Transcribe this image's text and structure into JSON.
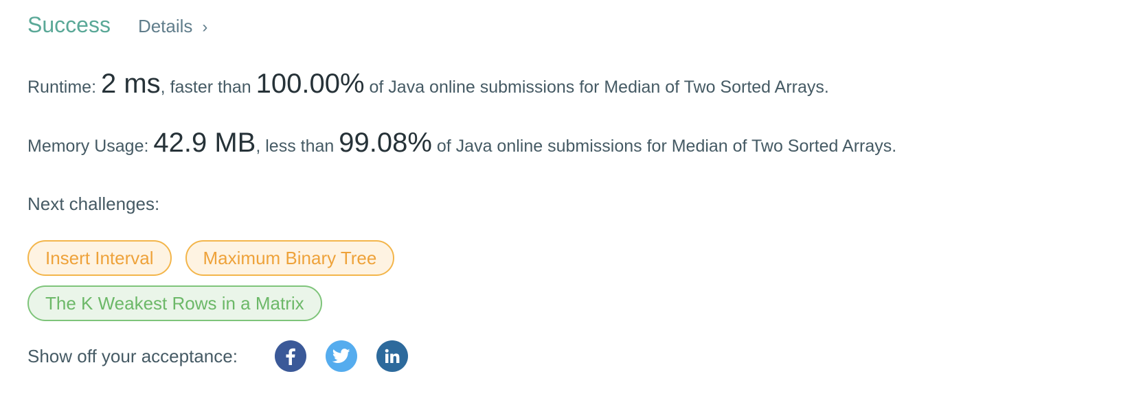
{
  "header": {
    "status": "Success",
    "details_label": "Details",
    "chevron": "›"
  },
  "runtime": {
    "label": "Runtime: ",
    "value": "2 ms",
    "comparison": ", faster than ",
    "percent": "100.00%",
    "suffix": " of Java online submissions for Median of Two Sorted Arrays."
  },
  "memory": {
    "label": "Memory Usage: ",
    "value": "42.9 MB",
    "comparison": ", less than ",
    "percent": "99.08%",
    "suffix": " of Java online submissions for Median of Two Sorted Arrays."
  },
  "next_challenges": {
    "label": "Next challenges:",
    "items": [
      {
        "label": "Insert Interval",
        "difficulty": "medium"
      },
      {
        "label": "Maximum Binary Tree",
        "difficulty": "medium"
      },
      {
        "label": "The K Weakest Rows in a Matrix",
        "difficulty": "easy"
      }
    ]
  },
  "share": {
    "label": "Show off your acceptance:",
    "icons": [
      {
        "name": "facebook-icon",
        "color": "#3b5998"
      },
      {
        "name": "twitter-icon",
        "color": "#55acee"
      },
      {
        "name": "linkedin-icon",
        "color": "#2d6a9c"
      }
    ]
  },
  "colors": {
    "success": "#5aa897",
    "medium_text": "#eea23a",
    "medium_bg": "#fef3e2",
    "easy_text": "#6cb868",
    "easy_bg": "#eaf5e9"
  }
}
